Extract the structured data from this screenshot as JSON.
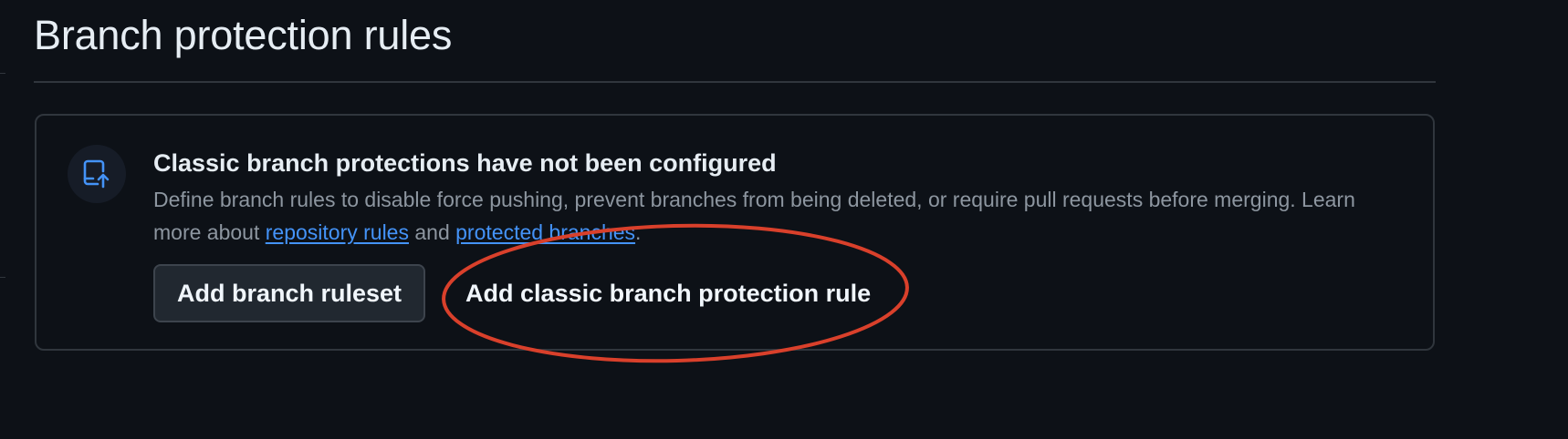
{
  "page": {
    "title": "Branch protection rules"
  },
  "empty_state": {
    "icon": "repo-push-icon",
    "heading": "Classic branch protections have not been configured",
    "description_before_links": "Define branch rules to disable force pushing, prevent branches from being deleted, or require pull requests before merging. Learn more about ",
    "link_repository_rules": "repository rules",
    "connector": " and ",
    "link_protected_branches": "protected branches",
    "description_end": "."
  },
  "actions": {
    "add_ruleset_label": "Add branch ruleset",
    "add_classic_rule_label": "Add classic branch protection rule"
  },
  "annotation": {
    "shape": "ellipse",
    "color": "#d9402b",
    "target": "Add classic branch protection rule"
  },
  "colors": {
    "background": "#0d1117",
    "border": "#30363d",
    "text_primary": "#e6edf3",
    "text_muted": "#8d96a0",
    "link": "#4493f8",
    "icon_accent": "#4493f8"
  }
}
